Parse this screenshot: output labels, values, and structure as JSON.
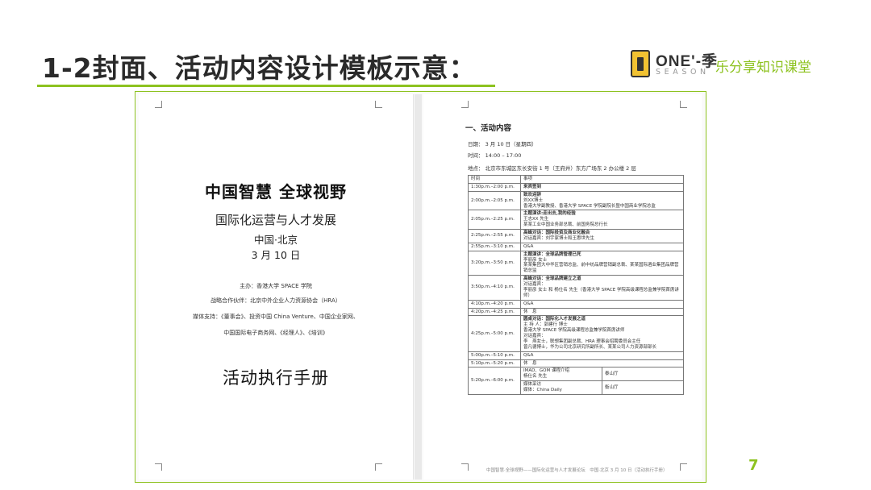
{
  "slide": {
    "title": "1-2封面、活动内容设计模板示意：",
    "page_number": "7"
  },
  "logo": {
    "brand": "ONE'-季",
    "season": "SEASON",
    "slogan": "乐分享知识课堂"
  },
  "cover": {
    "main_title": "中国智慧 全球视野",
    "subtitle": "国际化运营与人才发展",
    "city": "中国·北京",
    "date": "3 月 10 日",
    "host": "主办：香港大学 SPACE 学院",
    "partner": "战略合作伙伴：北京中外企业人力资源协会（HRA）",
    "media": "媒体支持：《董事会》、投资中国 China Venture、中国企业家网、",
    "media2": "中国国际电子商务网、《经理人》、《培训》",
    "manual": "活动执行手册"
  },
  "agenda_page": {
    "heading": "一、活动内容",
    "date_line": "日期：  3 月 10 日（星期四）",
    "time_line": "时间：  14:00 – 17:00",
    "location_line": "地点：  北京市东城区东长安街 1 号（王府井）东方广场东 2 办公楼 2 层",
    "header_time": "时间",
    "header_item": "事项",
    "rows": [
      {
        "time": "1:30p.m.–2:00 p.m.",
        "title": "来宾签到",
        "lines": []
      },
      {
        "time": "2:00p.m.–2:05 p.m.",
        "title": "致欢迎辞",
        "lines": [
          "刘XX博士",
          "香港大学副教授、香港大学 SPACE 学院副院长暨中国商业学院总监"
        ]
      },
      {
        "time": "2:05p.m.–2:25 p.m.",
        "title": "主题演讲:走出去,我的经验",
        "lines": [
          "王志XX 先生",
          "某某工业中国业务部总裁、前国务院总行长"
        ]
      },
      {
        "time": "2:25p.m.–2:55 p.m.",
        "title": "高峰对话：国际投资及商业化融合",
        "lines": [
          "对话嘉宾：刘宇家博士和王惠世先生"
        ]
      },
      {
        "time": "2:55p.m.–3:10 p.m.",
        "title": "",
        "lines": [
          "Q&A"
        ]
      },
      {
        "time": "3:20p.m.–3:50 p.m.",
        "title": "主题演讲：全球品牌管理已死",
        "lines": [
          "李丽彦 女士",
          "某某集团大中华区营销总监、前中纺品牌营销副总裁、某某国际酒业集团品牌营销总监"
        ]
      },
      {
        "time": "3:50p.m.–4:10 p.m.",
        "title": "高峰对话：全球品牌建立之道",
        "lines": [
          "对话嘉宾：",
          "李丽彦 女士 和 杨仕名 先生（香港大学 SPACE 学院高级课程总监兼学院首席讲师）"
        ]
      },
      {
        "time": "4:10p.m.–4:20 p.m.",
        "title": "",
        "lines": [
          "Q&A"
        ]
      },
      {
        "time": "4:20p.m.–4:25 p.m.",
        "title": "",
        "lines": [
          "休　息"
        ]
      },
      {
        "time": "4:25p.m.–5:00 p.m.",
        "title": "圆桌对话：国际化人才发展之道",
        "lines": [
          "主 持 人：郭建行 博士",
          "香港大学 SPACE 学院高级课程总监兼学院首席讲师",
          "对话嘉宾：",
          "李　燕女士，联想集团副总裁、HRA 理事会招聘委员会主任",
          "曾凡德博士，华为公司北京研究所副所长、某某公司人力资源部部长"
        ]
      },
      {
        "time": "5:00p.m.–5:10 p.m.",
        "title": "",
        "lines": [
          "Q&A"
        ]
      },
      {
        "time": "5:10p.m.–5:20 p.m.",
        "title": "",
        "lines": [
          "休　息"
        ]
      }
    ],
    "last_row": {
      "time": "5:20p.m.–6:00 p.m.",
      "a_lines": [
        "IMAD、GOM 课程介绍",
        "杨仕名 先生"
      ],
      "a_venue": "泰山厅",
      "b_lines": [
        "媒体采访",
        "媒体：China Daily"
      ],
      "b_venue": "衡山厅"
    },
    "footer": "中国智慧·全球视野——国际化运营与人才发展论坛　中国·北京 3 月 10 日（活动执行手册）"
  }
}
